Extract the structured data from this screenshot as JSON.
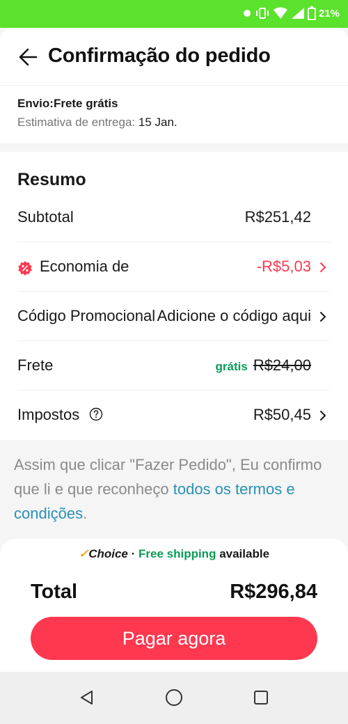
{
  "status_bar": {
    "battery": "21%"
  },
  "header": {
    "title": "Confirmação do pedido"
  },
  "shipping": {
    "title": "Envio:Frete grátis",
    "estimate_label": "Estimativa de entrega:",
    "estimate_date": "15 Jan."
  },
  "summary": {
    "title": "Resumo",
    "subtotal_label": "Subtotal",
    "subtotal_value": "R$251,42",
    "economy_label": "Economia de",
    "economy_value": "-R$5,03",
    "promo_label": "Código Promocional",
    "promo_value": "Adicione o código aqui",
    "shipping_label": "Frete",
    "shipping_free": "grátis",
    "shipping_original": "R$24,00",
    "taxes_label": "Impostos",
    "taxes_value": "R$50,45"
  },
  "terms": {
    "text": "Assim que clicar \"Fazer Pedido\", Eu confirmo que li e que reconheço ",
    "link": "todos os termos e condições",
    "end": "."
  },
  "bottom": {
    "choice_check": "✓",
    "choice_brand": "Choice",
    "choice_sep": " · ",
    "free_shipping": "Free shipping",
    "available": " available",
    "total_label": "Total",
    "total_value": "R$296,84",
    "pay_button": "Pagar agora"
  },
  "colors": {
    "status_bar": "#5ae22c",
    "accent_red": "#fd384f",
    "green": "#0a9b58",
    "link_blue": "#2a8fb6"
  },
  "icons": {
    "back": "arrow-left-icon",
    "chevron": "chevron-right-icon",
    "discount": "percent-badge-icon",
    "help": "question-circle-icon",
    "nav_back": "triangle-back-icon",
    "nav_home": "circle-home-icon",
    "nav_recents": "square-recents-icon"
  }
}
